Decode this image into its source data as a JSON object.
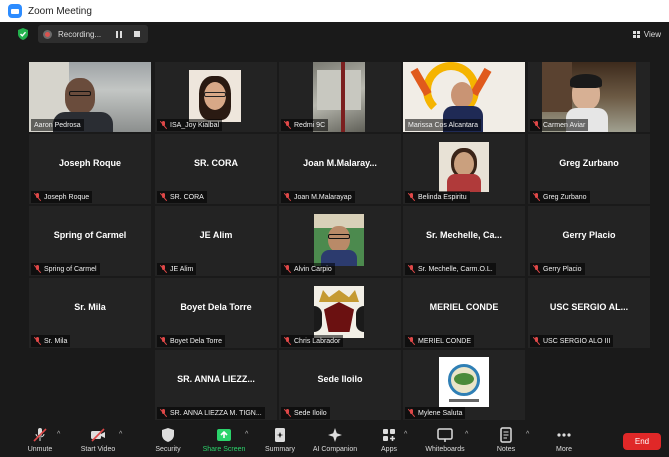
{
  "window": {
    "title": "Zoom Meeting"
  },
  "topbar": {
    "recording_label": "Recording...",
    "view_label": "View"
  },
  "tiles": [
    {
      "name": "Aaron Pedrosa"
    },
    {
      "name": "ISA_Joy Kialbal"
    },
    {
      "name": "Redmi 9C"
    },
    {
      "name": "Marissa Cos Alcantara"
    },
    {
      "name": "Carmen Aviar"
    },
    {
      "name": "Joseph Roque",
      "display": "Joseph Roque"
    },
    {
      "name": "SR. CORA",
      "display": "SR. CORA"
    },
    {
      "name": "Joan M.Malarayap",
      "display": "Joan M.Malaray..."
    },
    {
      "name": "Belinda Espiritu"
    },
    {
      "name": "Greg Zurbano",
      "display": "Greg Zurbano"
    },
    {
      "name": "Spring of Carmel",
      "display": "Spring of Carmel"
    },
    {
      "name": "JE Alim",
      "display": "JE Alim"
    },
    {
      "name": "Alvin Carpio"
    },
    {
      "name": "Sr. Mechelle, Carm.O.L.",
      "display": "Sr. Mechelle, Ca..."
    },
    {
      "name": "Gerry Placio",
      "display": "Gerry Placio"
    },
    {
      "name": "Sr. Mila",
      "display": "Sr. Mila"
    },
    {
      "name": "Boyet Dela Torre",
      "display": "Boyet Dela Torre"
    },
    {
      "name": "Chris Labrador"
    },
    {
      "name": "MERIEL CONDE",
      "display": "MERIEL CONDE"
    },
    {
      "name": "USC SERGIO ALO III",
      "display": "USC SERGIO AL..."
    },
    {
      "name": "SR. ANNA LIEZZA M. TIGN...",
      "display": "SR. ANNA LIEZZ..."
    },
    {
      "name": "Sede Iloilo",
      "display": "Sede Iloilo"
    },
    {
      "name": "Mylene Saluta"
    }
  ],
  "toolbar": {
    "unmute": "Unmute",
    "start_video": "Start Video",
    "security": "Security",
    "share_screen": "Share Screen",
    "summary": "Summary",
    "ai_companion": "AI Companion",
    "apps": "Apps",
    "whiteboards": "Whiteboards",
    "notes": "Notes",
    "more": "More",
    "end": "End"
  },
  "colors": {
    "active_speaker_border": "#d6e36b",
    "share_green": "#2bd36b",
    "end_red": "#e02828",
    "mic_off_red": "#e04848"
  }
}
